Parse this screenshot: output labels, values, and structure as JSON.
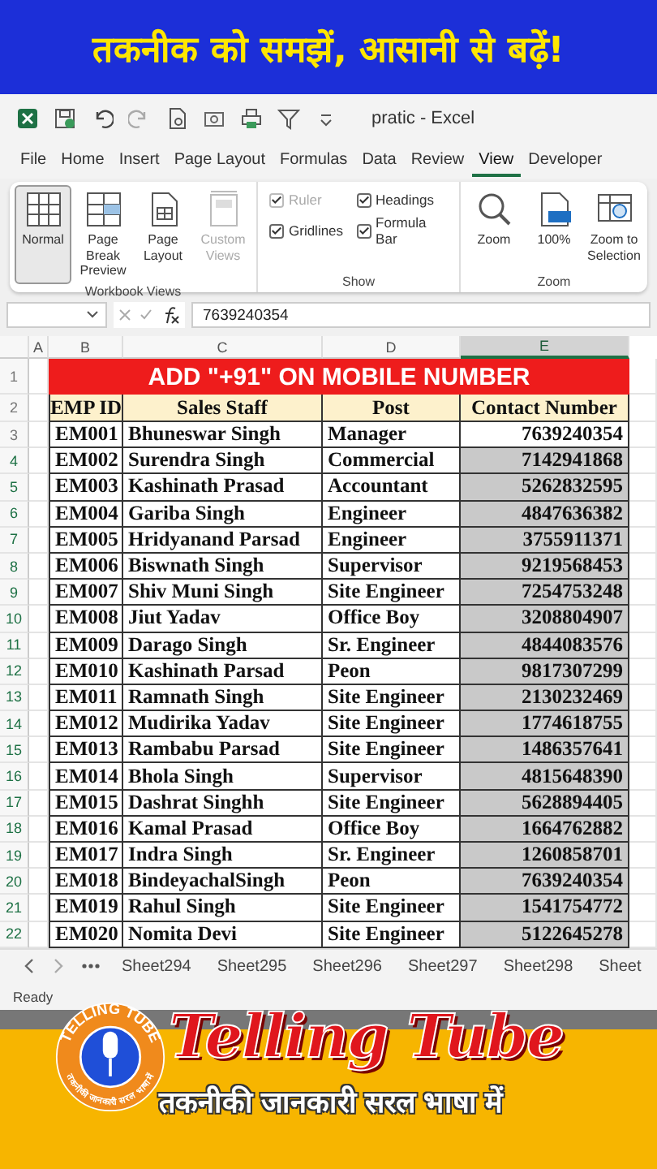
{
  "banner": {
    "title": "तकनीक को समझें, आसानी से बढ़ें!"
  },
  "window": {
    "title": "pratic  -  Excel"
  },
  "ribbon_tabs": [
    {
      "label": "File",
      "selected": false
    },
    {
      "label": "Home",
      "selected": false
    },
    {
      "label": "Insert",
      "selected": false
    },
    {
      "label": "Page Layout",
      "selected": false
    },
    {
      "label": "Formulas",
      "selected": false
    },
    {
      "label": "Data",
      "selected": false
    },
    {
      "label": "Review",
      "selected": false
    },
    {
      "label": "View",
      "selected": true
    },
    {
      "label": "Developer",
      "selected": false
    }
  ],
  "ribbon": {
    "workbook_views": {
      "label": "Workbook Views",
      "buttons": [
        {
          "kind": "normal",
          "label": "Normal",
          "selected": true,
          "disabled": false
        },
        {
          "kind": "page_break",
          "label": "Page Break Preview",
          "selected": false,
          "disabled": false
        },
        {
          "kind": "page_layout",
          "label": "Page Layout",
          "selected": false,
          "disabled": false
        },
        {
          "kind": "custom",
          "label": "Custom Views",
          "selected": false,
          "disabled": true
        }
      ]
    },
    "show": {
      "label": "Show",
      "options": [
        {
          "label": "Ruler",
          "checked": true,
          "disabled": true
        },
        {
          "label": "Headings",
          "checked": true,
          "disabled": false
        },
        {
          "label": "Gridlines",
          "checked": true,
          "disabled": false
        },
        {
          "label": "Formula Bar",
          "checked": true,
          "disabled": false
        }
      ]
    },
    "zoom": {
      "label": "Zoom",
      "buttons": [
        {
          "kind": "zoom",
          "label": "Zoom"
        },
        {
          "kind": "hundred",
          "label": "100%"
        },
        {
          "kind": "selection",
          "label": "Zoom to Selection"
        }
      ]
    }
  },
  "formula_bar": {
    "value": "7639240354"
  },
  "sheet": {
    "column_letters": [
      {
        "label": "A",
        "selected": false
      },
      {
        "label": "B",
        "selected": false
      },
      {
        "label": "C",
        "selected": false
      },
      {
        "label": "D",
        "selected": false
      },
      {
        "label": "E",
        "selected": true
      }
    ],
    "title_row": {
      "number": "1",
      "text": "ADD \"+91\" ON MOBILE NUMBER"
    },
    "header_row": {
      "number": "2",
      "cells": [
        "EMP ID",
        "Sales Staff",
        "Post",
        "Contact Number"
      ]
    },
    "rows": [
      {
        "number": "3",
        "cells": [
          "EM001",
          "Bhuneswar Singh",
          "Manager",
          "7639240354"
        ],
        "selected": false
      },
      {
        "number": "4",
        "cells": [
          "EM002",
          "Surendra Singh",
          "Commercial",
          "7142941868"
        ],
        "selected": true
      },
      {
        "number": "5",
        "cells": [
          "EM003",
          "Kashinath  Prasad",
          "Accountant",
          "5262832595"
        ],
        "selected": true
      },
      {
        "number": "6",
        "cells": [
          "EM004",
          "Gariba Singh",
          "Engineer",
          "4847636382"
        ],
        "selected": true
      },
      {
        "number": "7",
        "cells": [
          "EM005",
          "Hridyanand Parsad",
          "Engineer",
          "3755911371"
        ],
        "selected": true
      },
      {
        "number": "8",
        "cells": [
          "EM006",
          "Biswnath Singh",
          "Supervisor",
          "9219568453"
        ],
        "selected": true
      },
      {
        "number": "9",
        "cells": [
          "EM007",
          "Shiv Muni Singh",
          "Site Engineer",
          "7254753248"
        ],
        "selected": true
      },
      {
        "number": "10",
        "cells": [
          "EM008",
          "Jiut Yadav",
          "Office Boy",
          "3208804907"
        ],
        "selected": true
      },
      {
        "number": "11",
        "cells": [
          "EM009",
          "Darago Singh",
          "Sr. Engineer",
          "4844083576"
        ],
        "selected": true
      },
      {
        "number": "12",
        "cells": [
          "EM010",
          "Kashinath Parsad",
          "Peon",
          "9817307299"
        ],
        "selected": true
      },
      {
        "number": "13",
        "cells": [
          "EM011",
          "Ramnath Singh",
          "Site Engineer",
          "2130232469"
        ],
        "selected": true
      },
      {
        "number": "14",
        "cells": [
          "EM012",
          "Mudirika Yadav",
          "Site Engineer",
          "1774618755"
        ],
        "selected": true
      },
      {
        "number": "15",
        "cells": [
          "EM013",
          "Rambabu Parsad",
          "Site Engineer",
          "1486357641"
        ],
        "selected": true
      },
      {
        "number": "16",
        "cells": [
          "EM014",
          "Bhola Singh",
          "Supervisor",
          "4815648390"
        ],
        "selected": true
      },
      {
        "number": "17",
        "cells": [
          "EM015",
          "Dashrat Singhh",
          "Site Engineer",
          "5628894405"
        ],
        "selected": true
      },
      {
        "number": "18",
        "cells": [
          "EM016",
          "Kamal Prasad",
          "Office Boy",
          "1664762882"
        ],
        "selected": true
      },
      {
        "number": "19",
        "cells": [
          "EM017",
          "Indra Singh",
          "Sr. Engineer",
          "1260858701"
        ],
        "selected": true
      },
      {
        "number": "20",
        "cells": [
          "EM018",
          "BindeyachalSingh",
          "Peon",
          "7639240354"
        ],
        "selected": true
      },
      {
        "number": "21",
        "cells": [
          "EM019",
          "Rahul Singh",
          "Site Engineer",
          "1541754772"
        ],
        "selected": true
      },
      {
        "number": "22",
        "cells": [
          "EM020",
          "Nomita Devi",
          "Site Engineer",
          "5122645278"
        ],
        "selected": true
      }
    ]
  },
  "sheet_tabs": [
    "Sheet294",
    "Sheet295",
    "Sheet296",
    "Sheet297",
    "Sheet298",
    "Sheet"
  ],
  "status_bar": {
    "text": "Ready"
  },
  "brand": {
    "badge_text": "TELLING TUBE",
    "badge_subtitle": "तकनीकी जानकारी सरल भाषा में",
    "name": "Telling Tube",
    "tagline": "तकनीकी जानकारी सरल भाषा में"
  }
}
